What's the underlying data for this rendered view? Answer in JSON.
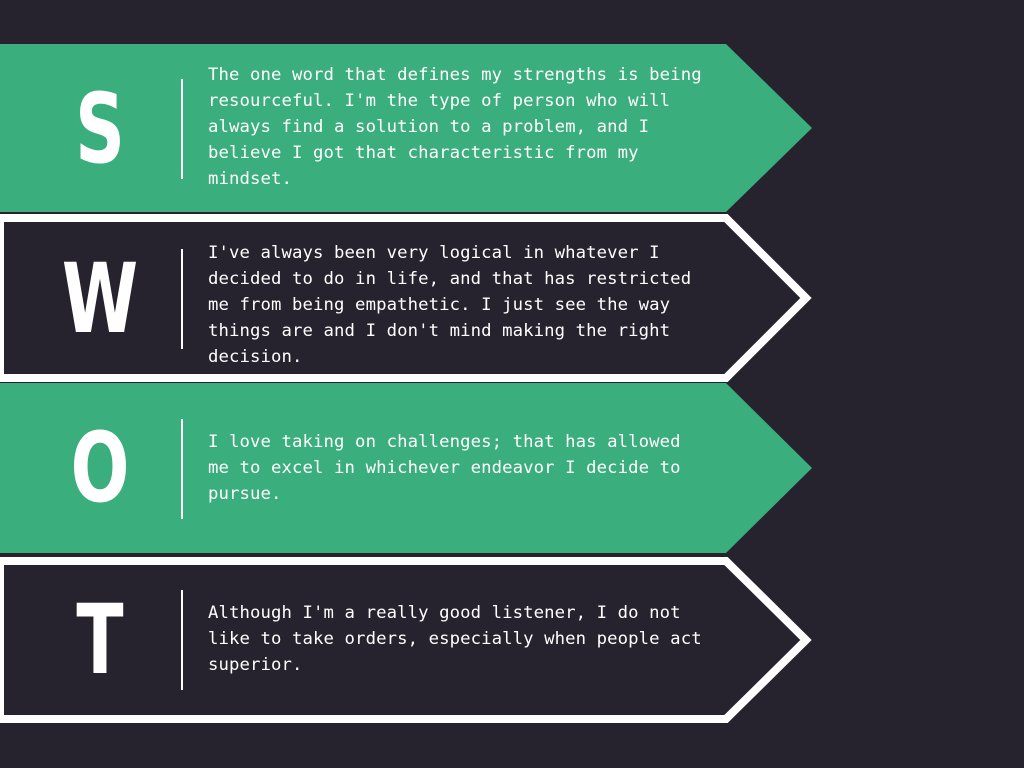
{
  "colors": {
    "background": "#26232e",
    "accent_green": "#3aae7c",
    "outline_white": "#ffffff",
    "text": "#ffffff"
  },
  "swot": [
    {
      "letter": "S",
      "fill": "#3aae7c",
      "text": "The one word that defines my strengths is being resourceful. I'm the type of person who will always find a solution to a problem, and I believe I got that characteristic from my mindset."
    },
    {
      "letter": "W",
      "fill": "#26232e",
      "text": "I've always been very logical in whatever I decided to do in life, and that has restricted me from being empathetic. I just see the way things are and I don't mind making the right decision."
    },
    {
      "letter": "O",
      "fill": "#3aae7c",
      "text": "I love taking on challenges; that has allowed me to excel in whichever endeavor I decide to pursue."
    },
    {
      "letter": "T",
      "fill": "#26232e",
      "text": "Although I'm a really good listener, I do not like to take orders, especially when people act superior."
    }
  ]
}
